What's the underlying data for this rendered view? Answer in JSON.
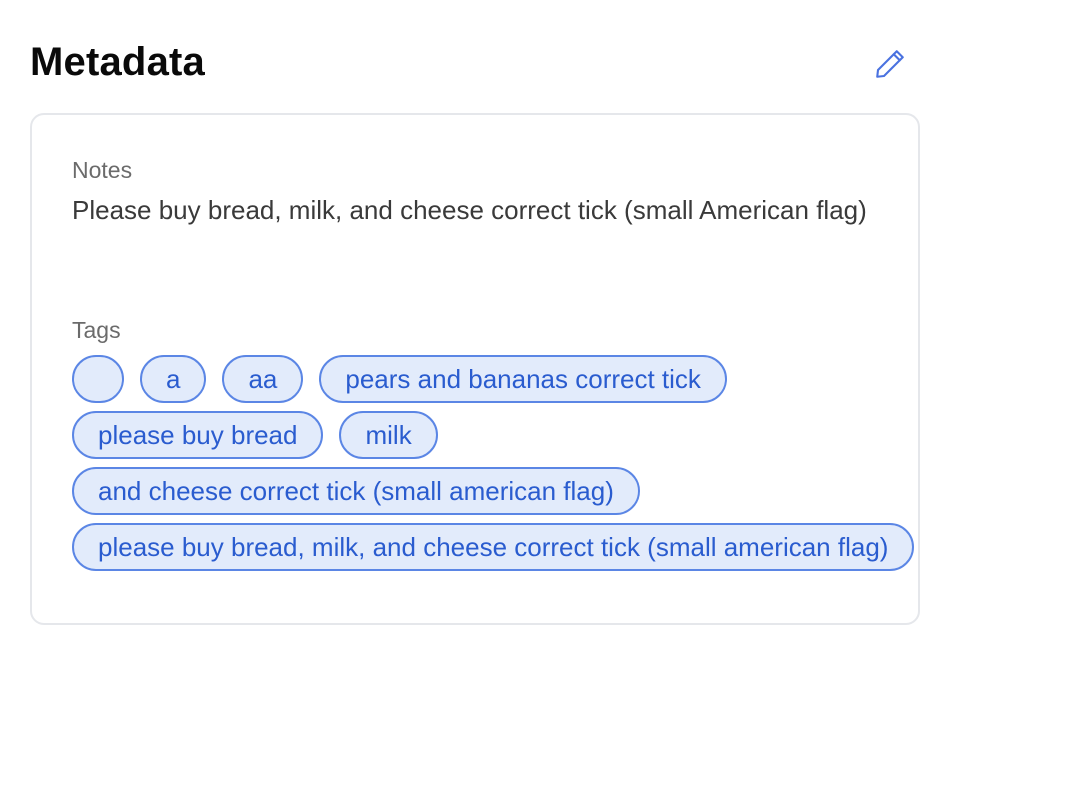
{
  "header": {
    "title": "Metadata"
  },
  "icons": {
    "edit": "pencil-icon"
  },
  "colors": {
    "accent": "#4a72e0",
    "tag_background": "#e2ebfb",
    "tag_border": "#5b86e5",
    "card_border": "#e5e7eb"
  },
  "card": {
    "notes_label": "Notes",
    "notes_value": "Please buy bread, milk, and cheese correct tick (small American flag)",
    "tags_label": "Tags",
    "tags": [
      "",
      "a",
      "aa",
      "pears and bananas correct tick",
      "please buy bread",
      "milk",
      "and cheese correct tick (small american flag)",
      "please buy bread, milk, and cheese correct tick (small american flag)"
    ]
  }
}
